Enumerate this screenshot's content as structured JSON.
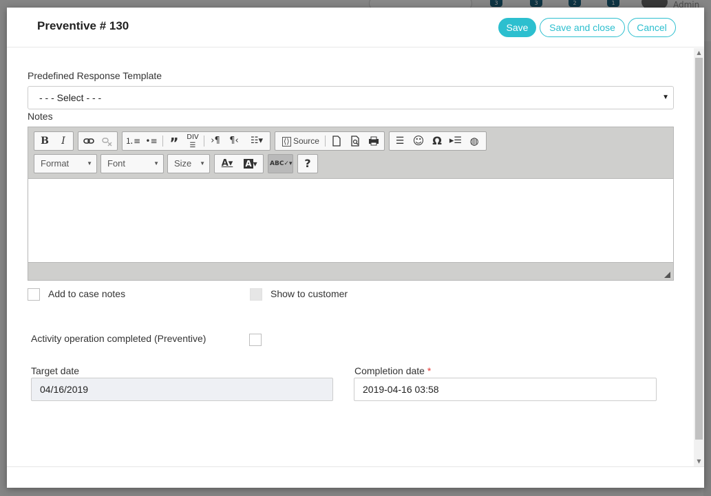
{
  "background": {
    "admin_label": "Admin",
    "badges": [
      "3",
      "3",
      "2",
      "1"
    ]
  },
  "modal": {
    "title": "Preventive # 130",
    "save_label": "Save",
    "save_close_label": "Save and close",
    "cancel_label": "Cancel"
  },
  "form": {
    "template_label": "Predefined Response Template",
    "template_value": "- - - Select - - -",
    "notes_label": "Notes",
    "editor": {
      "source_label": "Source",
      "format_label": "Format",
      "font_label": "Font",
      "size_label": "Size",
      "icons": [
        "bold-icon",
        "italic-icon",
        "link-icon",
        "unlink-icon",
        "numbered-list-icon",
        "bulleted-list-icon",
        "blockquote-icon",
        "div-icon",
        "ltr-icon",
        "rtl-icon",
        "language-icon",
        "source-icon",
        "new-page-icon",
        "preview-icon",
        "print-icon",
        "horizontal-line-icon",
        "smiley-icon",
        "special-char-icon",
        "page-break-icon",
        "iframe-icon",
        "text-color-icon",
        "bg-color-icon",
        "spellcheck-icon",
        "help-icon"
      ]
    },
    "add_to_case_notes_label": "Add to case notes",
    "show_to_customer_label": "Show to customer",
    "activity_completed_label": "Activity operation completed (Preventive)",
    "target_date_label": "Target date",
    "target_date_value": "04/16/2019",
    "completion_date_label": "Completion date",
    "completion_date_required": "*",
    "completion_date_value": "2019-04-16 03:58"
  },
  "colors": {
    "accent": "#2cbfcf",
    "required": "#e53935"
  }
}
